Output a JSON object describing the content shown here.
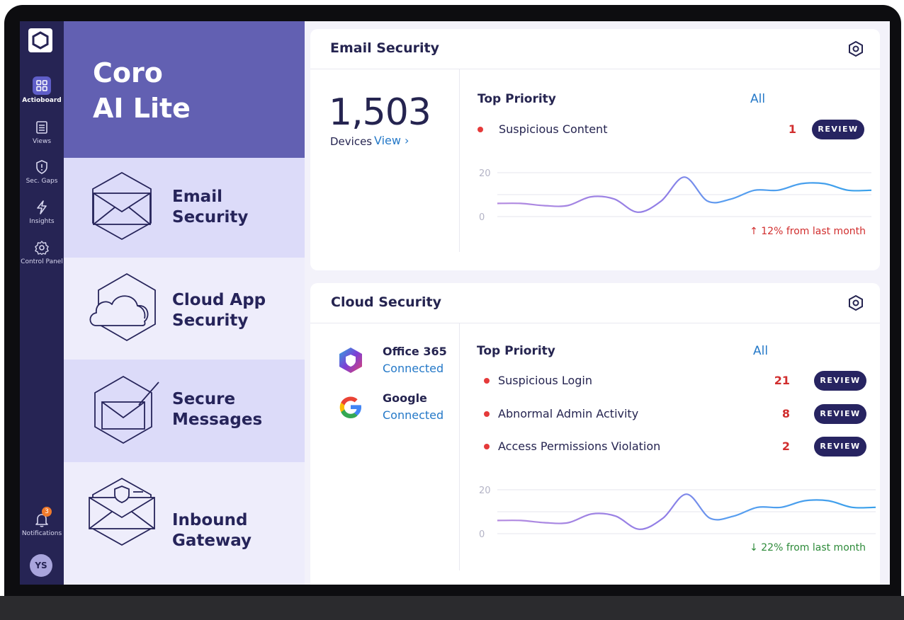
{
  "brand": {
    "line1": "Coro",
    "line2": "AI Lite"
  },
  "rail": {
    "items": [
      {
        "label": "Actioboard",
        "icon": "grid-icon"
      },
      {
        "label": "Views",
        "icon": "list-icon"
      },
      {
        "label": "Sec. Gaps",
        "icon": "shield-alert-icon"
      },
      {
        "label": "Insights",
        "icon": "lightning-icon"
      },
      {
        "label": "Control Panel",
        "icon": "gear-icon"
      }
    ],
    "notifications": {
      "label": "Notifications",
      "count": "3"
    },
    "avatar": "YS"
  },
  "products": [
    {
      "line1": "Email",
      "line2": "Security"
    },
    {
      "line1": "Cloud App",
      "line2": "Security"
    },
    {
      "line1": "Secure",
      "line2": "Messages"
    },
    {
      "line1": "Inbound",
      "line2": "Gateway"
    }
  ],
  "email_card": {
    "title": "Email Security",
    "devices_count": "1,503",
    "devices_label": "Devices",
    "view_label": "View ›",
    "top_priority": "Top Priority",
    "all_label": "All",
    "alerts": [
      {
        "name": "Suspicious Content",
        "count": "1",
        "action": "REVIEW"
      }
    ],
    "trend": "↑ 12% from last month",
    "trend_color": "#d12e2e"
  },
  "cloud_card": {
    "title": "Cloud Security",
    "connections": [
      {
        "name": "Office 365",
        "status": "Connected",
        "icon": "office365-icon"
      },
      {
        "name": "Google",
        "status": "Connected",
        "icon": "google-icon"
      }
    ],
    "top_priority": "Top Priority",
    "all_label": "All",
    "alerts": [
      {
        "name": "Suspicious Login",
        "count": "21",
        "action": "REVIEW"
      },
      {
        "name": "Abnormal Admin Activity",
        "count": "8",
        "action": "REVIEW"
      },
      {
        "name": "Access Permissions Violation",
        "count": "2",
        "action": "REVIEW"
      }
    ],
    "trend": "↓ 22% from last month",
    "trend_color": "#2e8b3a"
  },
  "chart_data": [
    {
      "type": "line",
      "yticks": [
        "20",
        "0"
      ],
      "ylim": [
        0,
        20
      ],
      "values": [
        6,
        6,
        5,
        5,
        9,
        8,
        2,
        7,
        18,
        7,
        8,
        12,
        12,
        15,
        15,
        12,
        12
      ]
    },
    {
      "type": "line",
      "yticks": [
        "20",
        "0"
      ],
      "ylim": [
        0,
        20
      ],
      "values": [
        6,
        6,
        5,
        5,
        9,
        8,
        2,
        7,
        18,
        7,
        8,
        12,
        12,
        15,
        15,
        12,
        12
      ]
    }
  ],
  "colors": {
    "rail": "#262454",
    "brand": "#6260b2",
    "accent": "#2579c8",
    "alert_dot": "#e53a3a",
    "review_button": "#272461"
  }
}
